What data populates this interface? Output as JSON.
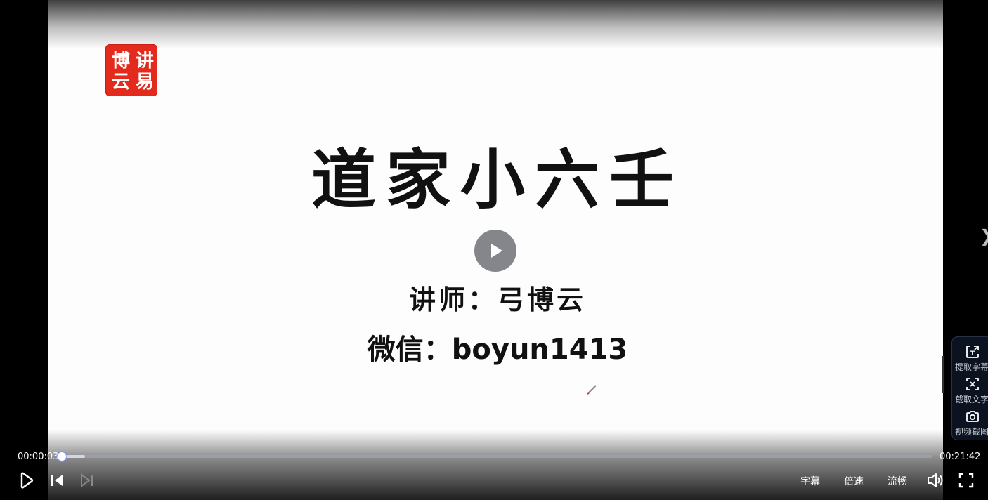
{
  "video": {
    "seal_text": "讲易博云",
    "title": "道家小六壬",
    "lecturer": "讲师：弓博云",
    "wechat": "微信：boyun1413"
  },
  "player": {
    "current_time": "00:00:03",
    "total_time": "00:21:42",
    "played_fraction": 0.002,
    "buffered_fraction": 0.028,
    "controls": {
      "subtitles_label": "字幕",
      "speed_label": "倍速",
      "quality_label": "流畅"
    }
  },
  "side_tools": [
    {
      "label": "提取字幕",
      "icon": "extract-subtitles-icon"
    },
    {
      "label": "截取文字",
      "icon": "capture-text-icon"
    },
    {
      "label": "视频截图",
      "icon": "screenshot-icon"
    }
  ],
  "next_arrow": "❯"
}
